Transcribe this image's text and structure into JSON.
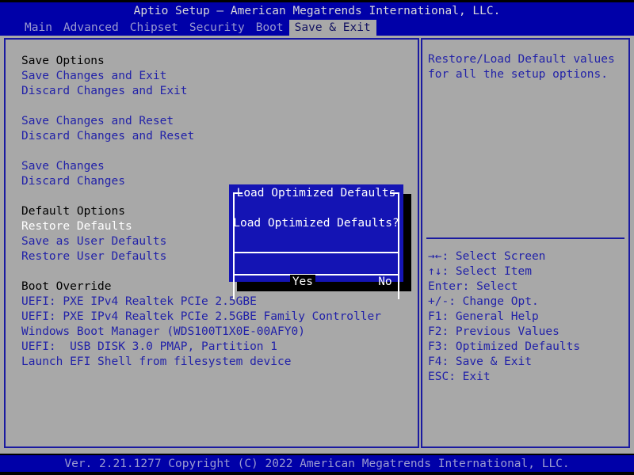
{
  "header": {
    "title": "Aptio Setup – American Megatrends International, LLC.",
    "tabs": [
      {
        "label": "Main",
        "active": false
      },
      {
        "label": "Advanced",
        "active": false
      },
      {
        "label": "Chipset",
        "active": false
      },
      {
        "label": "Security",
        "active": false
      },
      {
        "label": "Boot",
        "active": false
      },
      {
        "label": "Save & Exit",
        "active": true
      }
    ]
  },
  "left_panel": {
    "groups": [
      {
        "title": "Save Options",
        "items": [
          {
            "label": "Save Changes and Exit",
            "selected": false
          },
          {
            "label": "Discard Changes and Exit",
            "selected": false
          }
        ]
      },
      {
        "title": "",
        "items": [
          {
            "label": "Save Changes and Reset",
            "selected": false
          },
          {
            "label": "Discard Changes and Reset",
            "selected": false
          }
        ]
      },
      {
        "title": "",
        "items": [
          {
            "label": "Save Changes",
            "selected": false
          },
          {
            "label": "Discard Changes",
            "selected": false
          }
        ]
      },
      {
        "title": "Default Options",
        "items": [
          {
            "label": "Restore Defaults",
            "selected": true
          },
          {
            "label": "Save as User Defaults",
            "selected": false
          },
          {
            "label": "Restore User Defaults",
            "selected": false
          }
        ]
      },
      {
        "title": "Boot Override",
        "items": [
          {
            "label": "UEFI: PXE IPv4 Realtek PCIe 2.5GBE",
            "selected": false
          },
          {
            "label": "UEFI: PXE IPv4 Realtek PCIe 2.5GBE Family Controller",
            "selected": false
          },
          {
            "label": "Windows Boot Manager (WDS100T1X0E-00AFY0)",
            "selected": false
          },
          {
            "label": "UEFI:  USB DISK 3.0 PMAP, Partition 1",
            "selected": false
          },
          {
            "label": "Launch EFI Shell from filesystem device",
            "selected": false
          }
        ]
      }
    ]
  },
  "right_panel": {
    "help": [
      "Restore/Load Default values",
      "for all the setup options."
    ],
    "legend": [
      "→←: Select Screen",
      "↑↓: Select Item",
      "Enter: Select",
      "+/-: Change Opt.",
      "F1: General Help",
      "F2: Previous Values",
      "F3: Optimized Defaults",
      "F4: Save & Exit",
      "ESC: Exit"
    ]
  },
  "dialog": {
    "title": "Load Optimized Defaults",
    "question": "Load Optimized Defaults?",
    "buttons": [
      {
        "label": "Yes",
        "selected": true
      },
      {
        "label": "No",
        "selected": false
      }
    ]
  },
  "footer": {
    "text": "Ver. 2.21.1277 Copyright (C) 2022 American Megatrends International, LLC."
  },
  "colors": {
    "background_blue": "#0000a8",
    "panel_gray": "#a8a8a8",
    "option_blue": "#2222a8",
    "selected_white": "#ffffff",
    "border_blue": "#1a1aa0",
    "dialog_blue": "#1414b4",
    "tab_active_bg": "#a8a8a8",
    "tab_inactive_text": "#9a9ad0",
    "highlight_black": "#000000"
  }
}
